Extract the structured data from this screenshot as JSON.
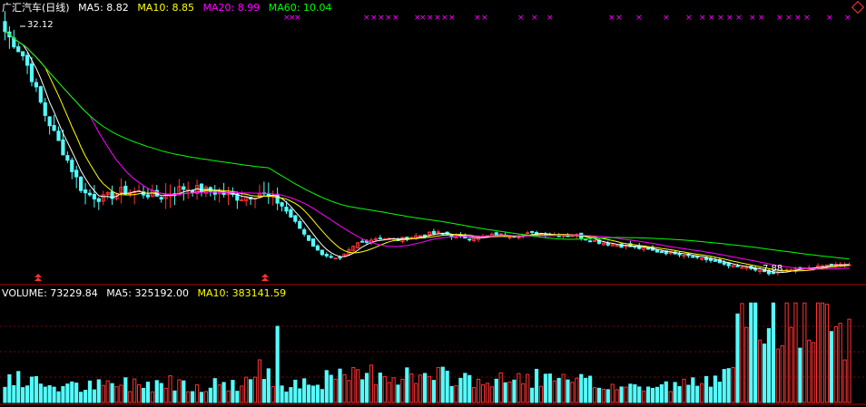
{
  "title": "广汇汽车(日线)",
  "ma_legend": [
    {
      "label": "MA5: 8.82",
      "color": "#ffffff"
    },
    {
      "label": "MA10: 8.85",
      "color": "#ffff00"
    },
    {
      "label": "MA20: 8.99",
      "color": "#ff00ff"
    },
    {
      "label": "MA60: 10.04",
      "color": "#00ff00"
    }
  ],
  "volume_legend": [
    {
      "label": "VOLUME: 73229.84",
      "color": "#ffffff"
    },
    {
      "label": "MA5: 325192.00",
      "color": "#ffffff"
    },
    {
      "label": "MA10: 383141.59",
      "color": "#ffff00"
    }
  ],
  "annotations": {
    "high": "32.12",
    "low": "7.88"
  },
  "colors": {
    "up": "#ff3232",
    "down": "#54fcfc",
    "ma5": "#ffffff",
    "ma10": "#ffff00",
    "ma20": "#ff00ff",
    "ma60": "#00ff00",
    "separator": "#b00000",
    "grid": "#800000",
    "marker": "#ff00ff"
  },
  "chart_data": {
    "type": "candlestick",
    "price_range": [
      7.0,
      34.0
    ],
    "high": 32.12,
    "low": 7.88,
    "last": {
      "ma5": 8.82,
      "ma10": 8.85,
      "ma20": 8.99,
      "ma60": 10.04
    },
    "anchors": [
      32.12,
      29.5,
      24,
      20,
      16,
      15.4,
      16.2,
      16,
      15.6,
      16.5,
      16.3,
      16,
      15.5,
      16,
      15,
      12.5,
      10,
      9.3,
      11,
      11.5,
      11.3,
      11.7,
      12,
      11.6,
      11.5,
      11.8,
      11.7,
      12,
      11.8,
      11.8,
      11.2,
      10.8,
      10.6,
      10.2,
      10,
      9.7,
      9.2,
      8.7,
      8.4,
      7.88,
      8.3,
      8.5,
      8.8,
      8.82
    ],
    "volume_anchors": [
      0.25,
      0.2,
      0.18,
      0.15,
      0.15,
      0.16,
      0.18,
      0.18,
      0.2,
      0.2,
      0.16,
      0.18,
      0.17,
      0.3,
      0.18,
      0.2,
      0.22,
      0.23,
      0.25,
      0.3,
      0.28,
      0.24,
      0.24,
      0.25,
      0.22,
      0.2,
      0.22,
      0.25,
      0.2,
      0.2,
      0.18,
      0.16,
      0.15,
      0.15,
      0.16,
      0.18,
      0.2,
      0.6,
      0.75,
      0.85,
      0.8,
      0.75,
      0.7,
      0.6
    ],
    "volume_spike": 0.75,
    "bar_count": 190
  }
}
